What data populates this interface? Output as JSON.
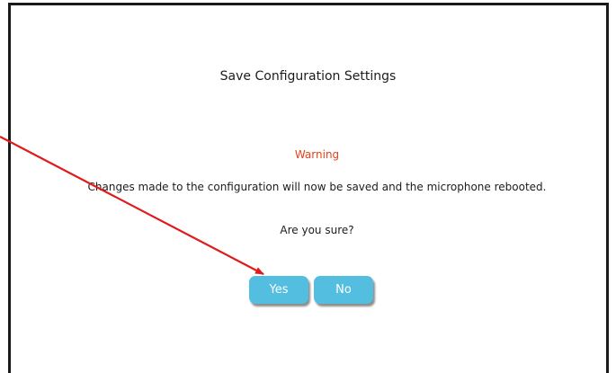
{
  "dialog": {
    "title": "Save Configuration Settings",
    "warning_label": "Warning",
    "message": "Changes made to the configuration will now be saved and the microphone rebooted.",
    "question": "Are you sure?",
    "yes_label": "Yes",
    "no_label": "No"
  },
  "colors": {
    "warning": "#e8401c",
    "button_bg": "#54bee0",
    "button_text": "#ffffff",
    "annotation_arrow": "#e01b1b"
  }
}
